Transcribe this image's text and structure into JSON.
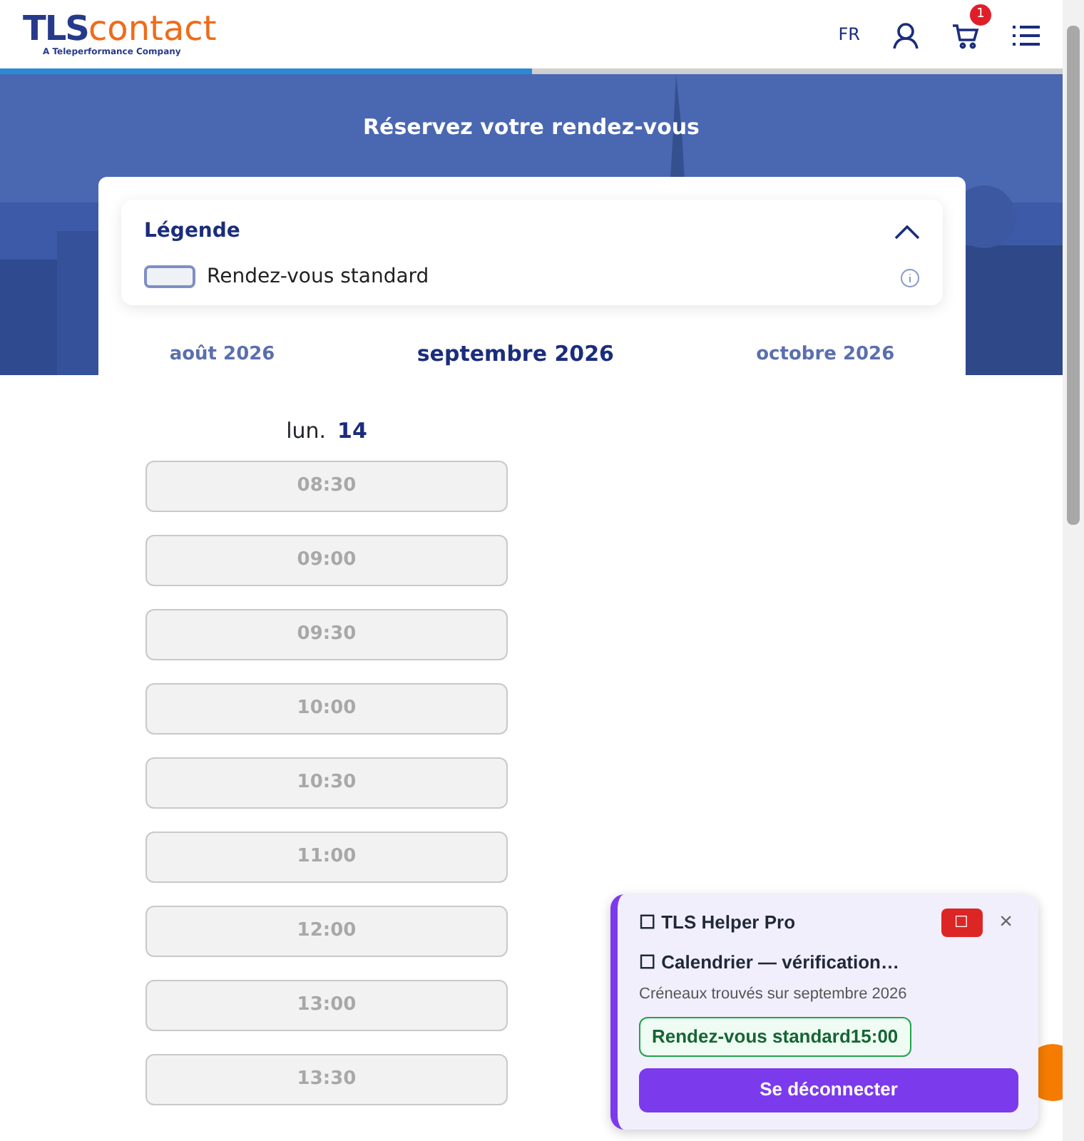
{
  "header": {
    "logo_main": "TLS",
    "logo_accent": "contact",
    "logo_tagline": "A Teleperformance Company",
    "language": "FR",
    "cart_count": "1",
    "progress": {
      "level": 0.5
    }
  },
  "hero": {
    "title": "Réservez votre rendez-vous"
  },
  "legend": {
    "title": "Légende",
    "expanded": true,
    "items": [
      {
        "label": "Rendez-vous standard"
      }
    ]
  },
  "months": [
    {
      "label": "août 2026",
      "selected": false
    },
    {
      "label": "septembre 2026",
      "selected": true
    },
    {
      "label": "octobre 2026",
      "selected": false
    }
  ],
  "day": {
    "weekday": "lun.",
    "date": "14"
  },
  "slots": [
    {
      "time": "08:30",
      "disabled": true
    },
    {
      "time": "09:00",
      "disabled": true
    },
    {
      "time": "09:30",
      "disabled": true
    },
    {
      "time": "10:00",
      "disabled": true
    },
    {
      "time": "10:30",
      "disabled": true
    },
    {
      "time": "11:00",
      "disabled": true
    },
    {
      "time": "12:00",
      "disabled": true
    },
    {
      "time": "13:00",
      "disabled": true
    },
    {
      "time": "13:30",
      "disabled": true
    }
  ],
  "helper": {
    "title": "☐ TLS Helper Pro",
    "stop_button": "☐",
    "close": "×",
    "status": "☐ Calendrier — vérification…",
    "subtitle": "Créneaux trouvés sur septembre 2026",
    "found": [
      "Rendez-vous standard15:00"
    ],
    "logout_button": "Se déconnecter"
  }
}
